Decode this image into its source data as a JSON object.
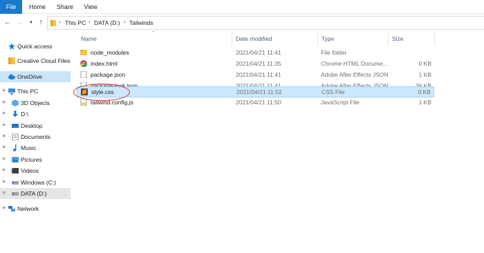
{
  "ribbon": {
    "tabs": [
      {
        "label": "File"
      },
      {
        "label": "Home"
      },
      {
        "label": "Share"
      },
      {
        "label": "View"
      }
    ]
  },
  "address": {
    "crumbs": [
      "This PC",
      "DATA (D:)",
      "Tailwinds"
    ]
  },
  "columns": {
    "name": "Name",
    "date": "Date modified",
    "type": "Type",
    "size": "Size"
  },
  "sidebar": {
    "items": [
      {
        "label": "Quick access",
        "icon": "star-icon"
      },
      {
        "label": "Creative Cloud Files",
        "icon": "creative-cloud-icon"
      },
      {
        "label": "OneDrive",
        "icon": "cloud-icon"
      },
      {
        "label": "This PC",
        "icon": "computer-icon"
      },
      {
        "label": "3D Objects",
        "icon": "cube-icon"
      },
      {
        "label": "D:\\",
        "icon": "download-icon"
      },
      {
        "label": "Desktop",
        "icon": "desktop-icon"
      },
      {
        "label": "Documents",
        "icon": "documents-icon"
      },
      {
        "label": "Music",
        "icon": "music-icon"
      },
      {
        "label": "Pictures",
        "icon": "pictures-icon"
      },
      {
        "label": "Videos",
        "icon": "videos-icon"
      },
      {
        "label": "Windows (C:)",
        "icon": "drive-icon"
      },
      {
        "label": "DATA (D:)",
        "icon": "drive-icon"
      },
      {
        "label": "Network",
        "icon": "network-icon"
      }
    ]
  },
  "files": [
    {
      "name": "node_modules",
      "date": "2021/04/21 11:41",
      "type": "File folder",
      "size": "",
      "icon": "folder-icon"
    },
    {
      "name": "index.html",
      "date": "2021/04/21 11:35",
      "type": "Chrome HTML Docume...",
      "size": "0 KB",
      "icon": "chrome-icon"
    },
    {
      "name": "package.json",
      "date": "2021/04/21 11:41",
      "type": "Adobe After Effects JSON",
      "size": "1 KB",
      "icon": "file-icon"
    },
    {
      "name": "package-lock.json",
      "date": "2021/04/21 11:41",
      "type": "Adobe After Effects JSON",
      "size": "36 KB",
      "icon": "file-icon"
    },
    {
      "name": "style.css",
      "date": "2021/04/21 11:52",
      "type": "CSS File",
      "size": "0 KB",
      "icon": "sublime-icon"
    },
    {
      "name": "tailwind.config.js",
      "date": "2021/04/21 11:50",
      "type": "JavaScript File",
      "size": "1 KB",
      "icon": "js-file-icon"
    }
  ],
  "colors": {
    "accent": "#1979ca",
    "selection": "#cce8ff",
    "annotation": "#d42a2a"
  }
}
